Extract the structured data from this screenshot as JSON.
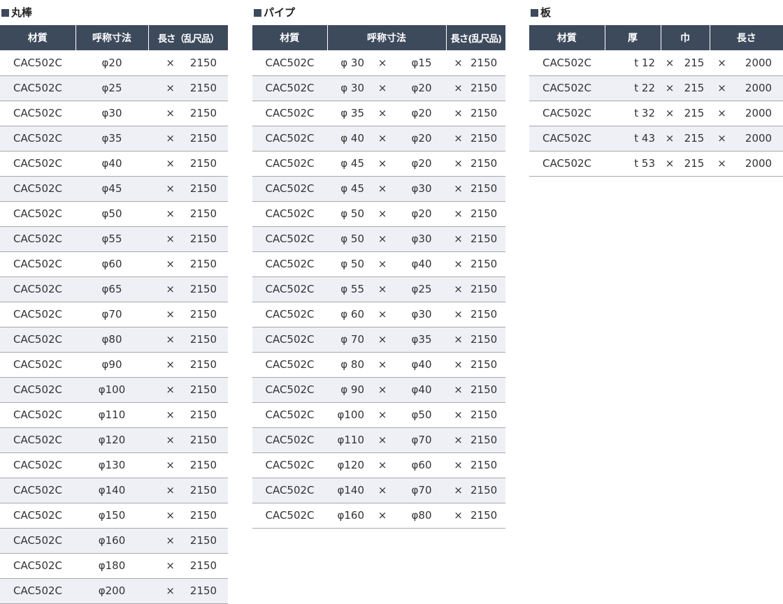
{
  "sections": {
    "round_bar": {
      "title": "丸棒",
      "headers": [
        "材質",
        "呼称寸法",
        "長さ（乱尺品）"
      ],
      "rows": [
        {
          "material": "CAC502C",
          "size": "φ20",
          "times": "×",
          "length": "2150"
        },
        {
          "material": "CAC502C",
          "size": "φ25",
          "times": "×",
          "length": "2150"
        },
        {
          "material": "CAC502C",
          "size": "φ30",
          "times": "×",
          "length": "2150"
        },
        {
          "material": "CAC502C",
          "size": "φ35",
          "times": "×",
          "length": "2150"
        },
        {
          "material": "CAC502C",
          "size": "φ40",
          "times": "×",
          "length": "2150"
        },
        {
          "material": "CAC502C",
          "size": "φ45",
          "times": "×",
          "length": "2150"
        },
        {
          "material": "CAC502C",
          "size": "φ50",
          "times": "×",
          "length": "2150"
        },
        {
          "material": "CAC502C",
          "size": "φ55",
          "times": "×",
          "length": "2150"
        },
        {
          "material": "CAC502C",
          "size": "φ60",
          "times": "×",
          "length": "2150"
        },
        {
          "material": "CAC502C",
          "size": "φ65",
          "times": "×",
          "length": "2150"
        },
        {
          "material": "CAC502C",
          "size": "φ70",
          "times": "×",
          "length": "2150"
        },
        {
          "material": "CAC502C",
          "size": "φ80",
          "times": "×",
          "length": "2150"
        },
        {
          "material": "CAC502C",
          "size": "φ90",
          "times": "×",
          "length": "2150"
        },
        {
          "material": "CAC502C",
          "size": "φ100",
          "times": "×",
          "length": "2150"
        },
        {
          "material": "CAC502C",
          "size": "φ110",
          "times": "×",
          "length": "2150"
        },
        {
          "material": "CAC502C",
          "size": "φ120",
          "times": "×",
          "length": "2150"
        },
        {
          "material": "CAC502C",
          "size": "φ130",
          "times": "×",
          "length": "2150"
        },
        {
          "material": "CAC502C",
          "size": "φ140",
          "times": "×",
          "length": "2150"
        },
        {
          "material": "CAC502C",
          "size": "φ150",
          "times": "×",
          "length": "2150"
        },
        {
          "material": "CAC502C",
          "size": "φ160",
          "times": "×",
          "length": "2150"
        },
        {
          "material": "CAC502C",
          "size": "φ180",
          "times": "×",
          "length": "2150"
        },
        {
          "material": "CAC502C",
          "size": "φ200",
          "times": "×",
          "length": "2150"
        }
      ]
    },
    "pipe": {
      "title": "パイプ",
      "headers": [
        "材質",
        "呼称寸法",
        "長さ(乱尺品)"
      ],
      "rows": [
        {
          "material": "CAC502C",
          "od": "φ 30",
          "x1": "×",
          "id": "φ15",
          "x2": "×",
          "length": "2150"
        },
        {
          "material": "CAC502C",
          "od": "φ 30",
          "x1": "×",
          "id": "φ20",
          "x2": "×",
          "length": "2150"
        },
        {
          "material": "CAC502C",
          "od": "φ 35",
          "x1": "×",
          "id": "φ20",
          "x2": "×",
          "length": "2150"
        },
        {
          "material": "CAC502C",
          "od": "φ 40",
          "x1": "×",
          "id": "φ20",
          "x2": "×",
          "length": "2150"
        },
        {
          "material": "CAC502C",
          "od": "φ 45",
          "x1": "×",
          "id": "φ20",
          "x2": "×",
          "length": "2150"
        },
        {
          "material": "CAC502C",
          "od": "φ 45",
          "x1": "×",
          "id": "φ30",
          "x2": "×",
          "length": "2150"
        },
        {
          "material": "CAC502C",
          "od": "φ 50",
          "x1": "×",
          "id": "φ20",
          "x2": "×",
          "length": "2150"
        },
        {
          "material": "CAC502C",
          "od": "φ 50",
          "x1": "×",
          "id": "φ30",
          "x2": "×",
          "length": "2150"
        },
        {
          "material": "CAC502C",
          "od": "φ 50",
          "x1": "×",
          "id": "φ40",
          "x2": "×",
          "length": "2150"
        },
        {
          "material": "CAC502C",
          "od": "φ 55",
          "x1": "×",
          "id": "φ25",
          "x2": "×",
          "length": "2150"
        },
        {
          "material": "CAC502C",
          "od": "φ 60",
          "x1": "×",
          "id": "φ30",
          "x2": "×",
          "length": "2150"
        },
        {
          "material": "CAC502C",
          "od": "φ 70",
          "x1": "×",
          "id": "φ35",
          "x2": "×",
          "length": "2150"
        },
        {
          "material": "CAC502C",
          "od": "φ 80",
          "x1": "×",
          "id": "φ40",
          "x2": "×",
          "length": "2150"
        },
        {
          "material": "CAC502C",
          "od": "φ 90",
          "x1": "×",
          "id": "φ40",
          "x2": "×",
          "length": "2150"
        },
        {
          "material": "CAC502C",
          "od": "φ100",
          "x1": "×",
          "id": "φ50",
          "x2": "×",
          "length": "2150"
        },
        {
          "material": "CAC502C",
          "od": "φ110",
          "x1": "×",
          "id": "φ70",
          "x2": "×",
          "length": "2150"
        },
        {
          "material": "CAC502C",
          "od": "φ120",
          "x1": "×",
          "id": "φ60",
          "x2": "×",
          "length": "2150"
        },
        {
          "material": "CAC502C",
          "od": "φ140",
          "x1": "×",
          "id": "φ70",
          "x2": "×",
          "length": "2150"
        },
        {
          "material": "CAC502C",
          "od": "φ160",
          "x1": "×",
          "id": "φ80",
          "x2": "×",
          "length": "2150"
        }
      ]
    },
    "plate": {
      "title": "板",
      "headers": [
        "材質",
        "厚",
        "巾",
        "長さ"
      ],
      "rows": [
        {
          "material": "CAC502C",
          "thickness": "t 12",
          "x1": "×",
          "width": "215",
          "x2": "×",
          "length": "2000"
        },
        {
          "material": "CAC502C",
          "thickness": "t 22",
          "x1": "×",
          "width": "215",
          "x2": "×",
          "length": "2000"
        },
        {
          "material": "CAC502C",
          "thickness": "t 32",
          "x1": "×",
          "width": "215",
          "x2": "×",
          "length": "2000"
        },
        {
          "material": "CAC502C",
          "thickness": "t 43",
          "x1": "×",
          "width": "215",
          "x2": "×",
          "length": "2000"
        },
        {
          "material": "CAC502C",
          "thickness": "t 53",
          "x1": "×",
          "width": "215",
          "x2": "×",
          "length": "2000"
        }
      ]
    }
  }
}
